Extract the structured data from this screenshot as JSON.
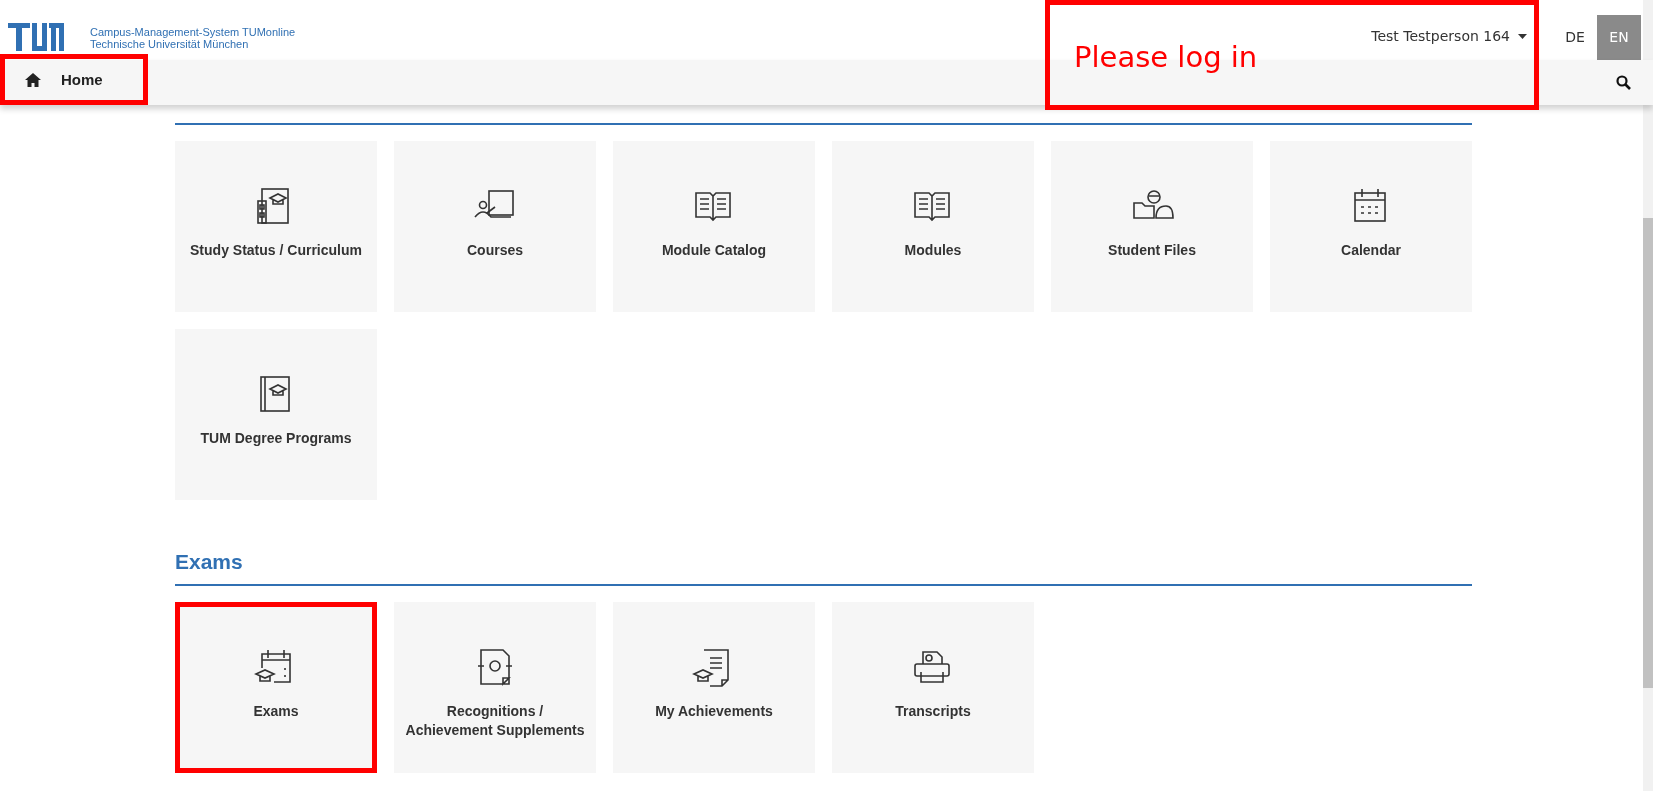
{
  "header": {
    "system_name": "Campus-Management-System TUMonline",
    "university": "Technische Universität München",
    "user_menu": "Test Testperson 164",
    "languages": [
      {
        "label": "DE",
        "selected": false
      },
      {
        "label": "EN",
        "selected": true
      }
    ]
  },
  "nav": {
    "home": {
      "label": "Home",
      "highlighted": true
    }
  },
  "annotation": {
    "text": "Please log in"
  },
  "sections": [
    {
      "tiles": [
        {
          "label": "Study Status / Curriculum",
          "highlighted": false
        },
        {
          "label": "Courses",
          "highlighted": false
        },
        {
          "label": "Module Catalog",
          "highlighted": false
        },
        {
          "label": "Modules",
          "highlighted": false
        },
        {
          "label": "Student Files",
          "highlighted": false
        },
        {
          "label": "Calendar",
          "highlighted": false
        },
        {
          "label": "TUM Degree Programs",
          "highlighted": false
        }
      ]
    },
    {
      "title": "Exams",
      "tiles": [
        {
          "label": "Exams",
          "highlighted": true
        },
        {
          "label": "Recognitions / Achievement Supplements",
          "highlighted": false
        },
        {
          "label": "My Achievements",
          "highlighted": false
        },
        {
          "label": "Transcripts",
          "highlighted": false
        }
      ]
    }
  ]
}
